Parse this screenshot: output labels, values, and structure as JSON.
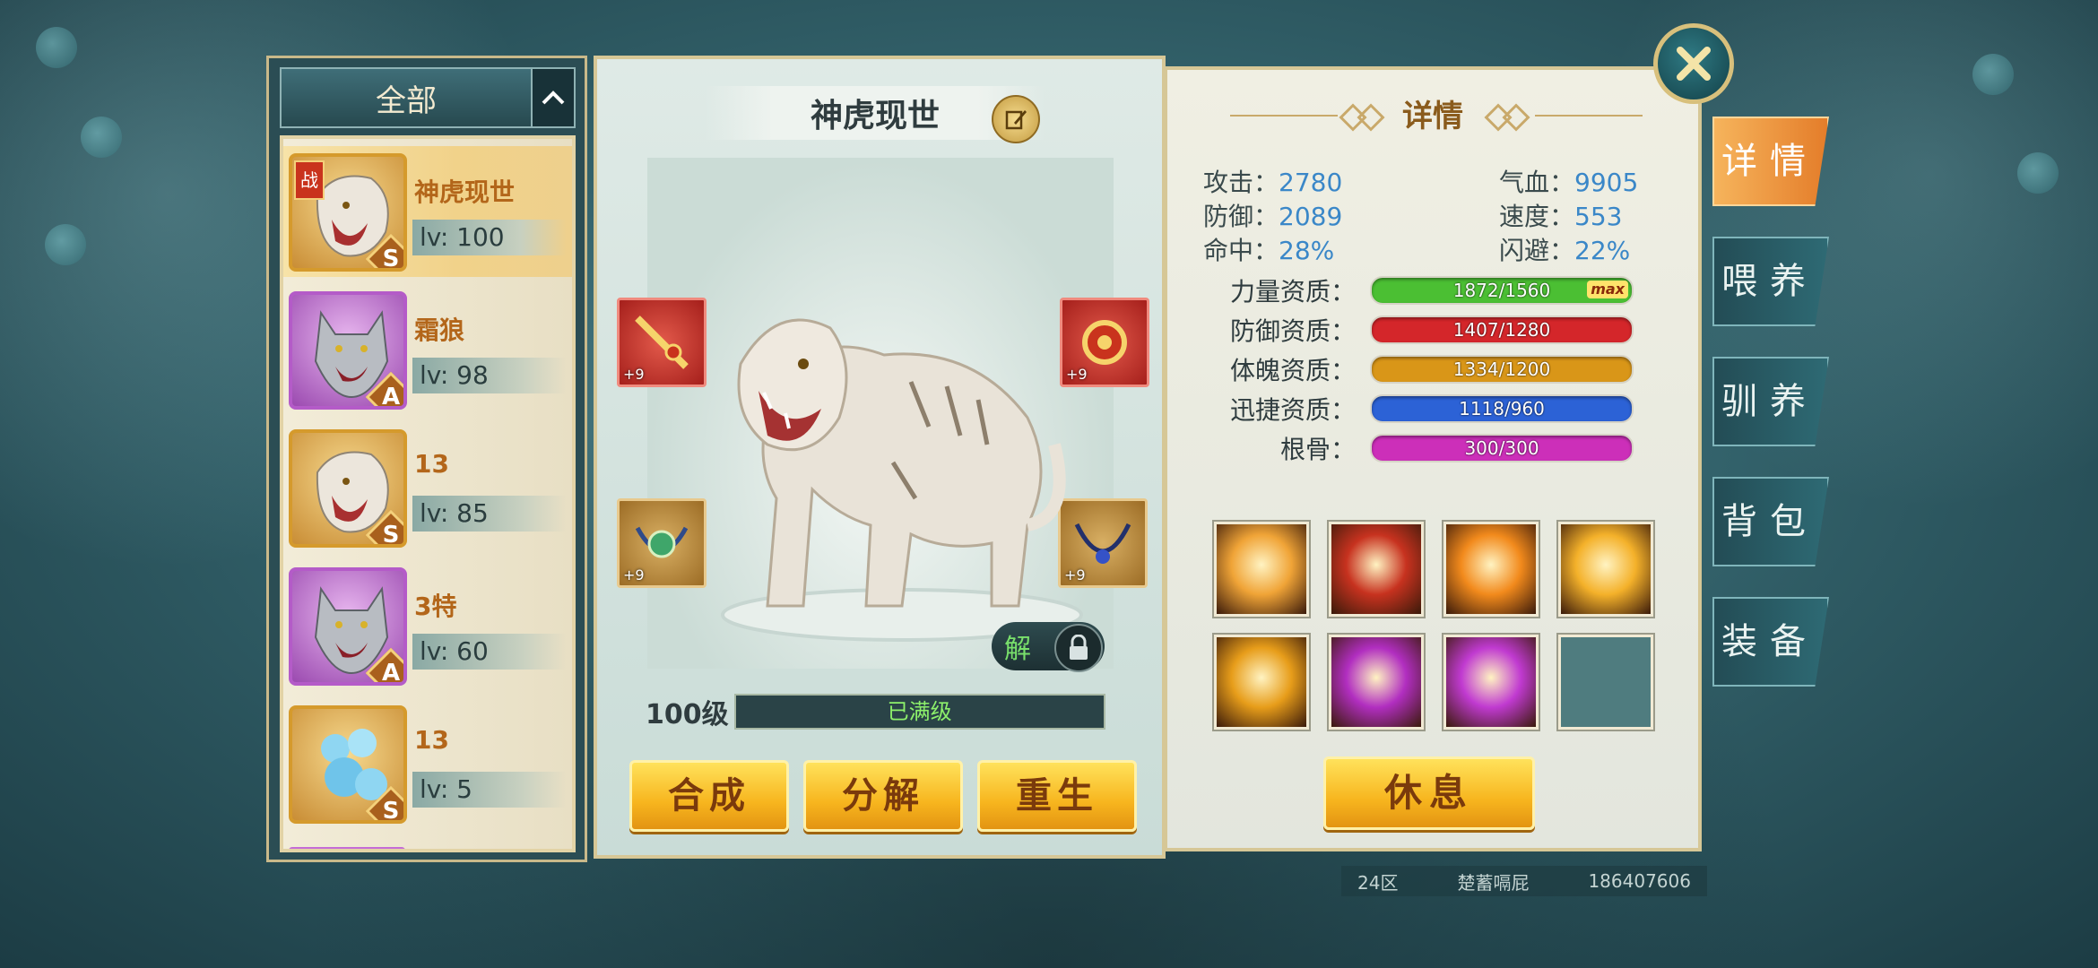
{
  "filter": {
    "label": "全部",
    "toggle_icon": "chevron-up-icon"
  },
  "pets": [
    {
      "name": "神虎现世",
      "level": "lv: 100",
      "grade": "S",
      "type": "tiger",
      "frame": "gold",
      "war_badge": "战",
      "active": true
    },
    {
      "name": "霜狼",
      "level": "lv: 98",
      "grade": "A",
      "type": "wolf",
      "frame": "purple",
      "active": false
    },
    {
      "name": "13",
      "level": "lv: 85",
      "grade": "S",
      "type": "tiger",
      "frame": "gold",
      "active": false
    },
    {
      "name": "3特",
      "level": "lv: 60",
      "grade": "A",
      "type": "wolf",
      "frame": "purple",
      "active": false
    },
    {
      "name": "13",
      "level": "lv: 5",
      "grade": "S",
      "type": "ice-serpent",
      "frame": "gold",
      "active": false
    }
  ],
  "selected_pet": {
    "title": "神虎现世",
    "gear_plus": [
      "+9",
      "+9",
      "+9",
      "+9"
    ],
    "unlock_label": "解",
    "level_label": "100级",
    "level_status": "已满级"
  },
  "actions": {
    "synthesize": "合成",
    "decompose": "分解",
    "rebirth": "重生"
  },
  "details": {
    "title": "详情",
    "stats": [
      {
        "label": "攻击：",
        "value": "2780"
      },
      {
        "label": "气血：",
        "value": "9905"
      },
      {
        "label": "防御：",
        "value": "2089"
      },
      {
        "label": "速度：",
        "value": "553"
      },
      {
        "label": "命中：",
        "value": "28%"
      },
      {
        "label": "闪避：",
        "value": "22%"
      }
    ],
    "aptitudes": [
      {
        "label": "力量资质：",
        "value": "1872/1560",
        "fill": 1.0,
        "color": "#4bbf33",
        "max": "max"
      },
      {
        "label": "防御资质：",
        "value": "1407/1280",
        "fill": 1.0,
        "color": "#d4262a"
      },
      {
        "label": "体魄资质：",
        "value": "1334/1200",
        "fill": 1.0,
        "color": "#d99618"
      },
      {
        "label": "迅捷资质：",
        "value": "1118/960",
        "fill": 1.0,
        "color": "#2c62d6"
      },
      {
        "label": "根骨：",
        "value": "300/300",
        "fill": 1.0,
        "color": "#cc2fb9"
      }
    ],
    "skills": [
      {
        "icon": "lion-roar-skill-icon",
        "color": "#f0a437"
      },
      {
        "icon": "fire-orb-skill-icon",
        "color": "#c7321f"
      },
      {
        "icon": "phoenix-flame-skill-icon",
        "color": "#f28a1c"
      },
      {
        "icon": "golden-burst-skill-icon",
        "color": "#f4b12a"
      },
      {
        "icon": "golden-claw-skill-icon",
        "color": "#e79d1a"
      },
      {
        "icon": "purple-slash-skill-icon",
        "color": "#b12ec0"
      },
      {
        "icon": "purple-lightning-skill-icon",
        "color": "#c03ad0"
      },
      {
        "icon": "empty-skill-slot-icon",
        "color": "#4f7c7f"
      }
    ],
    "rest_label": "休息"
  },
  "tabs": [
    {
      "label": "详情",
      "active": true
    },
    {
      "label": "喂养",
      "active": false
    },
    {
      "label": "驯养",
      "active": false
    },
    {
      "label": "背包",
      "active": false
    },
    {
      "label": "装备",
      "active": false
    }
  ],
  "footer": {
    "server": "24区",
    "player": "楚蓄嗝屁",
    "id": "186407606"
  }
}
